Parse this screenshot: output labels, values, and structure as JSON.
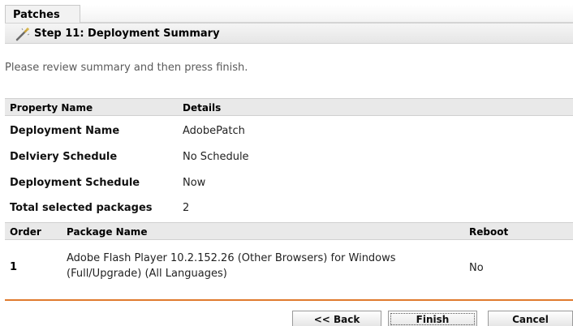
{
  "tab": {
    "label": "Patches"
  },
  "step": {
    "title": "Step 11: Deployment Summary",
    "icon": "wand-icon"
  },
  "intro": "Please review summary and then press finish.",
  "properties": {
    "headers": {
      "name": "Property Name",
      "details": "Details"
    },
    "rows": [
      {
        "name": "Deployment Name",
        "value": "AdobePatch"
      },
      {
        "name": "Delviery Schedule",
        "value": "No Schedule"
      },
      {
        "name": "Deployment Schedule",
        "value": "Now"
      },
      {
        "name": "Total selected packages",
        "value": "2"
      }
    ]
  },
  "packages": {
    "headers": {
      "order": "Order",
      "name": "Package Name",
      "reboot": "Reboot"
    },
    "rows": [
      {
        "order": "1",
        "name": "Adobe Flash Player 10.2.152.26 (Other Browsers) for Windows (Full/Upgrade) (All Languages)",
        "reboot": "No"
      }
    ]
  },
  "buttons": {
    "back": "<< Back",
    "finish": "Finish",
    "cancel": "Cancel"
  },
  "colors": {
    "accent_rule": "#e07a2e",
    "header_bg": "#e9e9e9"
  }
}
